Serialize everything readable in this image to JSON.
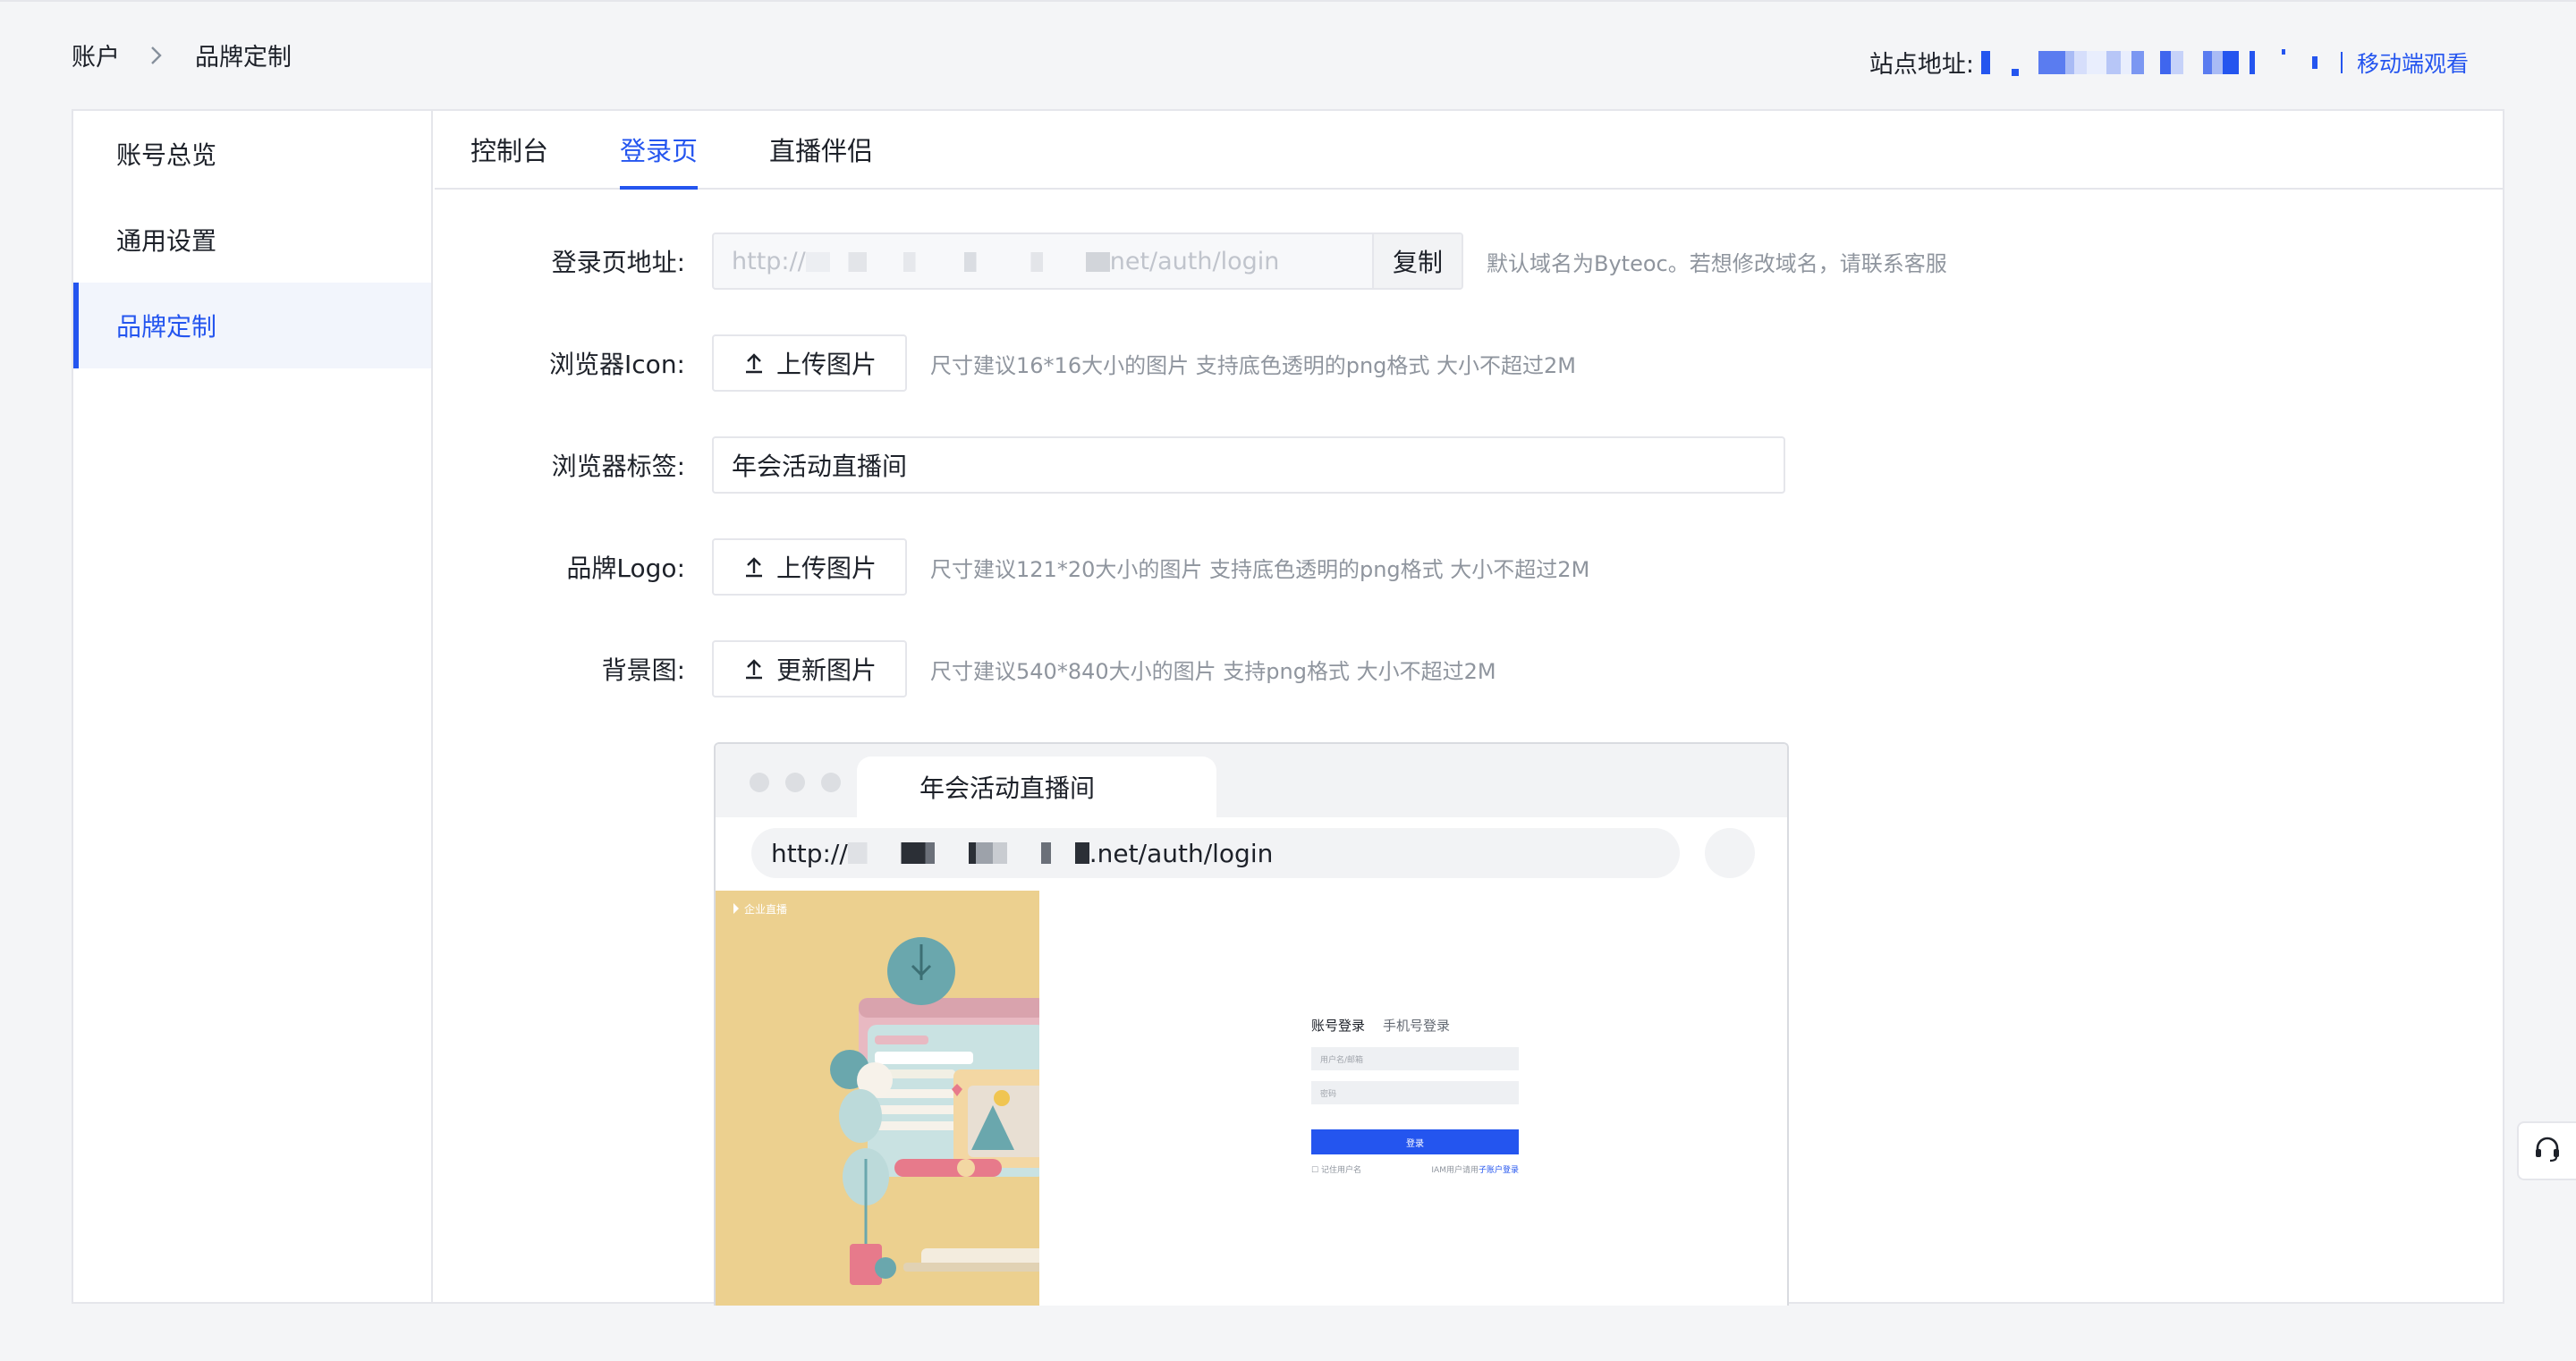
{
  "breadcrumb": {
    "root": "账户",
    "current": "品牌定制"
  },
  "site": {
    "label": "站点地址:",
    "mobile_link": "移动端观看"
  },
  "sidebar": {
    "items": [
      {
        "label": "账号总览"
      },
      {
        "label": "通用设置"
      },
      {
        "label": "品牌定制"
      }
    ]
  },
  "tabs": [
    {
      "label": "控制台"
    },
    {
      "label": "登录页"
    },
    {
      "label": "直播伴侣"
    }
  ],
  "form": {
    "login_url": {
      "label": "登录页地址:",
      "value_suffix": "net/auth/login",
      "value_prefix": "http://",
      "copy_label": "复制",
      "hint": "默认域名为Byteoc。若想修改域名，请联系客服"
    },
    "browser_icon": {
      "label": "浏览器Icon:",
      "button": "上传图片",
      "hint": "尺寸建议16*16大小的图片  支持底色透明的png格式  大小不超过2M"
    },
    "browser_tab": {
      "label": "浏览器标签:",
      "value": "年会活动直播间"
    },
    "brand_logo": {
      "label": "品牌Logo:",
      "button": "上传图片",
      "hint": "尺寸建议121*20大小的图片  支持底色透明的png格式  大小不超过2M"
    },
    "background": {
      "label": "背景图:",
      "button": "更新图片",
      "hint": "尺寸建议540*840大小的图片  支持png格式  大小不超过2M"
    }
  },
  "preview": {
    "tab_title": "年会活动直播间",
    "url_prefix": "http://",
    "url_suffix": ".net/auth/login",
    "brand": "企业直播",
    "login": {
      "tab_account": "账号登录",
      "tab_phone": "手机号登录",
      "username_placeholder": "用户名/邮箱",
      "password_placeholder": "密码",
      "submit": "登录",
      "remember": "记住用户名",
      "iam_text": "IAM用户请用",
      "iam_link": "子账户登录"
    }
  },
  "colors": {
    "accent": "#2455ef",
    "illustration_bg": "#ecd08f"
  },
  "icons": {
    "breadcrumb_separator": "chevron-right-icon",
    "upload": "upload-icon",
    "support": "headset-icon"
  }
}
